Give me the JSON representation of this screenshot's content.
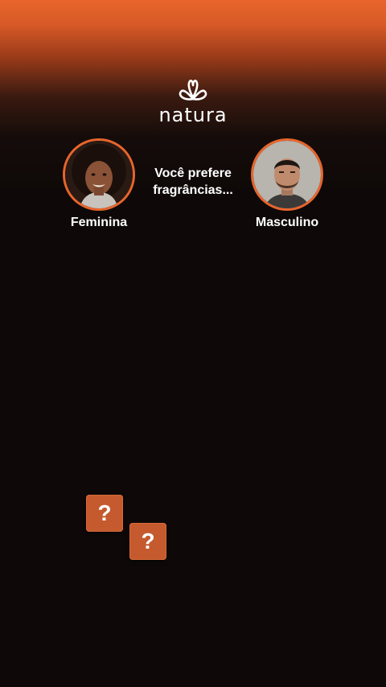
{
  "brand": {
    "name": "natura"
  },
  "prompt": {
    "question": "Você prefere fragrâncias..."
  },
  "choices": [
    {
      "label": "Feminina"
    },
    {
      "label": "Masculino"
    }
  ],
  "game": {
    "tiles": [
      {
        "symbol": "?"
      },
      {
        "symbol": "?"
      }
    ]
  },
  "colors": {
    "accent": "#e8652c",
    "background": "#0e0908",
    "tile": "#c45a2d"
  }
}
